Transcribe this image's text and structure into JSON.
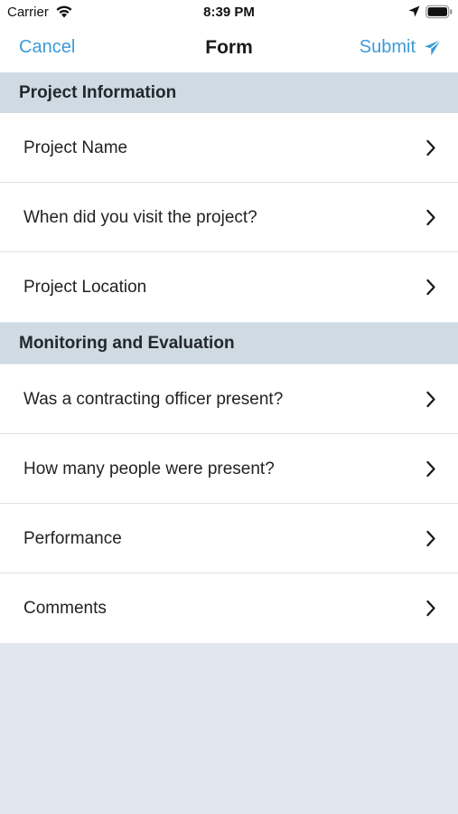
{
  "status_bar": {
    "carrier": "Carrier",
    "time": "8:39 PM"
  },
  "nav": {
    "cancel": "Cancel",
    "title": "Form",
    "submit": "Submit"
  },
  "sections": [
    {
      "title": "Project Information",
      "items": [
        "Project Name",
        "When did you visit the project?",
        "Project Location"
      ]
    },
    {
      "title": "Monitoring and Evaluation",
      "items": [
        "Was a contracting officer present?",
        "How many people were present?",
        "Performance",
        "Comments"
      ]
    }
  ],
  "colors": {
    "accent": "#3d9ad8",
    "section_header": "#cfdae2",
    "page_background": "#e1e7ee"
  },
  "icons": {
    "row_disclosure": "chevron-right-icon",
    "submit": "send-icon"
  }
}
